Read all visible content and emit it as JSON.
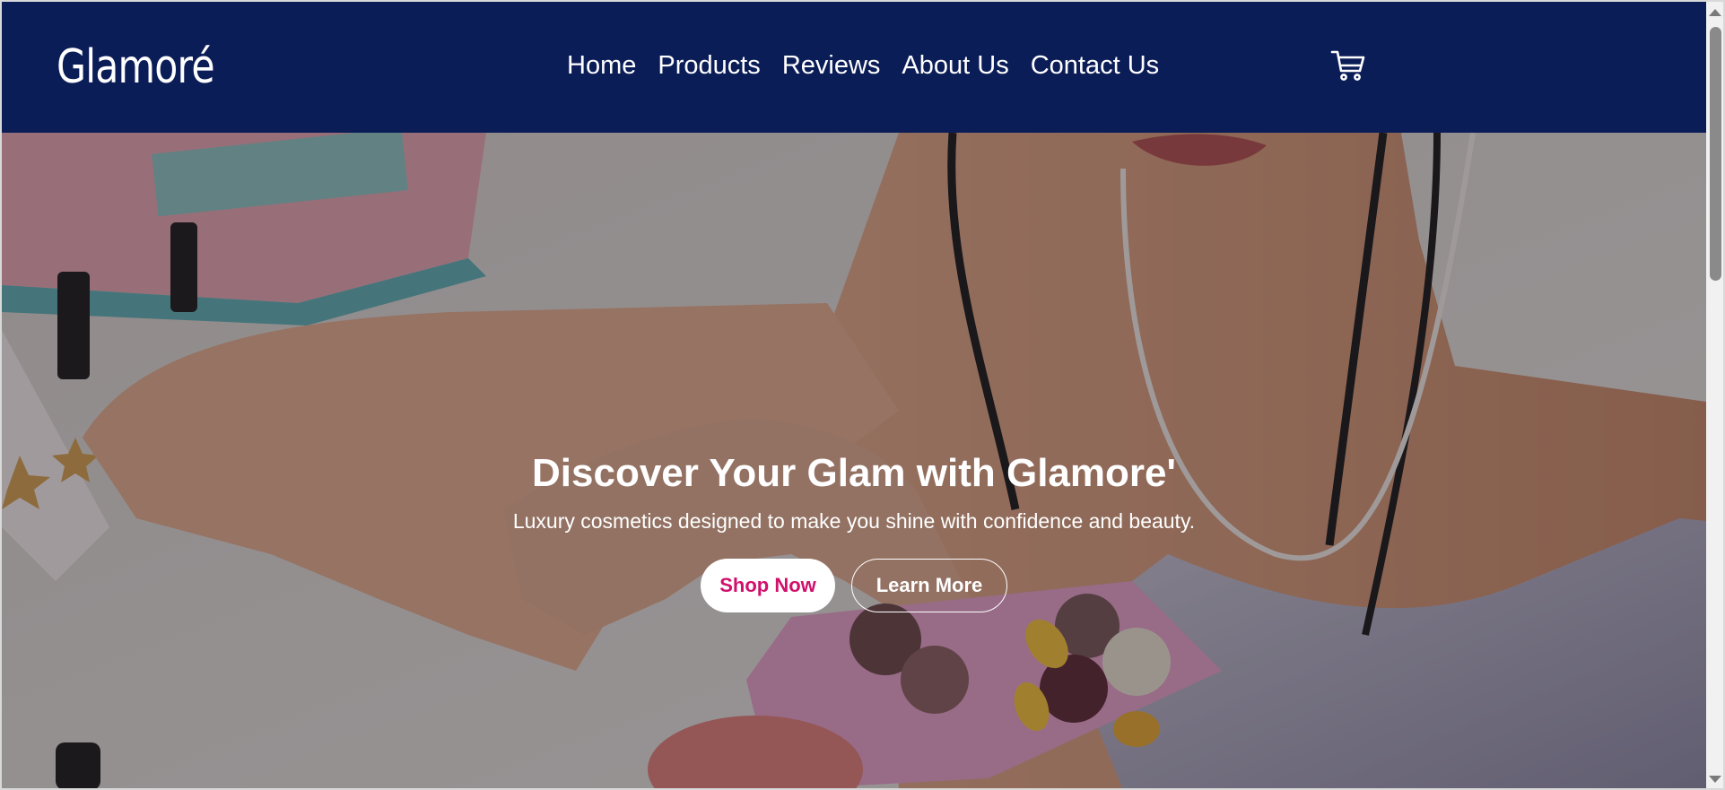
{
  "brand": {
    "logo_text": "Glamoré"
  },
  "nav": {
    "items": [
      {
        "label": "Home"
      },
      {
        "label": "Products"
      },
      {
        "label": "Reviews"
      },
      {
        "label": "About Us"
      },
      {
        "label": "Contact Us"
      }
    ],
    "cart_icon": "shopping-cart-icon"
  },
  "hero": {
    "title": "Discover Your Glam with Glamore'",
    "subtitle": "Luxury cosmetics designed to make you shine with confidence and beauty.",
    "primary_button": "Shop Now",
    "secondary_button": "Learn More",
    "background_image": "woman applying eyeshadow palette at desk"
  },
  "colors": {
    "navbar": "#0b1d57",
    "accent": "#d0106b",
    "text_light": "#ffffff"
  }
}
